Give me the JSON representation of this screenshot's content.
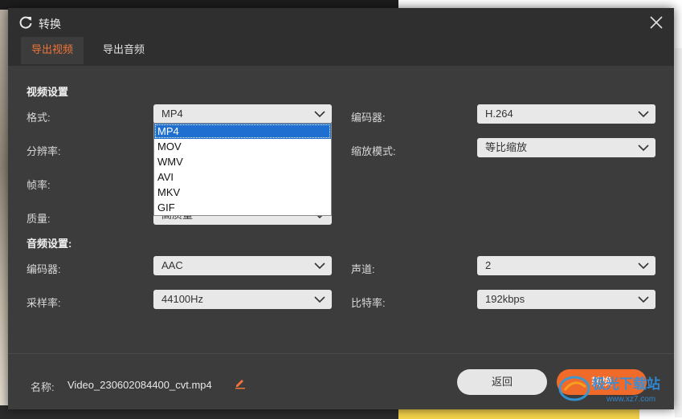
{
  "window": {
    "title": "转换",
    "close_icon": "close-icon",
    "refresh_icon": "convert-icon"
  },
  "tabs": [
    {
      "label": "导出视频",
      "active": true
    },
    {
      "label": "导出音频",
      "active": false
    }
  ],
  "video": {
    "section_title": "视频设置",
    "format": {
      "label": "格式:",
      "value": "MP4",
      "options": [
        "MP4",
        "MOV",
        "WMV",
        "AVI",
        "MKV",
        "GIF"
      ]
    },
    "encoder": {
      "label": "编码器:",
      "value": "H.264"
    },
    "resolution": {
      "label": "分辨率:"
    },
    "scale_mode": {
      "label": "缩放模式:",
      "value": "等比缩放"
    },
    "frame_rate": {
      "label": "帧率:"
    },
    "quality": {
      "label": "质量:",
      "value": "高质量"
    }
  },
  "audio": {
    "section_title": "音频设置:",
    "encoder": {
      "label": "编码器:",
      "value": "AAC"
    },
    "channel": {
      "label": "声道:",
      "value": "2"
    },
    "sample_rate": {
      "label": "采样率:",
      "value": "44100Hz"
    },
    "bitrate": {
      "label": "比特率:",
      "value": "192kbps"
    }
  },
  "footer": {
    "name_label": "名称:",
    "name_value": "Video_230602084400_cvt.mp4",
    "back_label": "返回",
    "convert_label": "转换"
  },
  "colors": {
    "accent": "#f0743a",
    "dialog_bg": "#3c3c3c",
    "selected_option": "#1f6fd0"
  },
  "watermark": {
    "text": "极光下载站",
    "url": "www.xz7.com"
  }
}
